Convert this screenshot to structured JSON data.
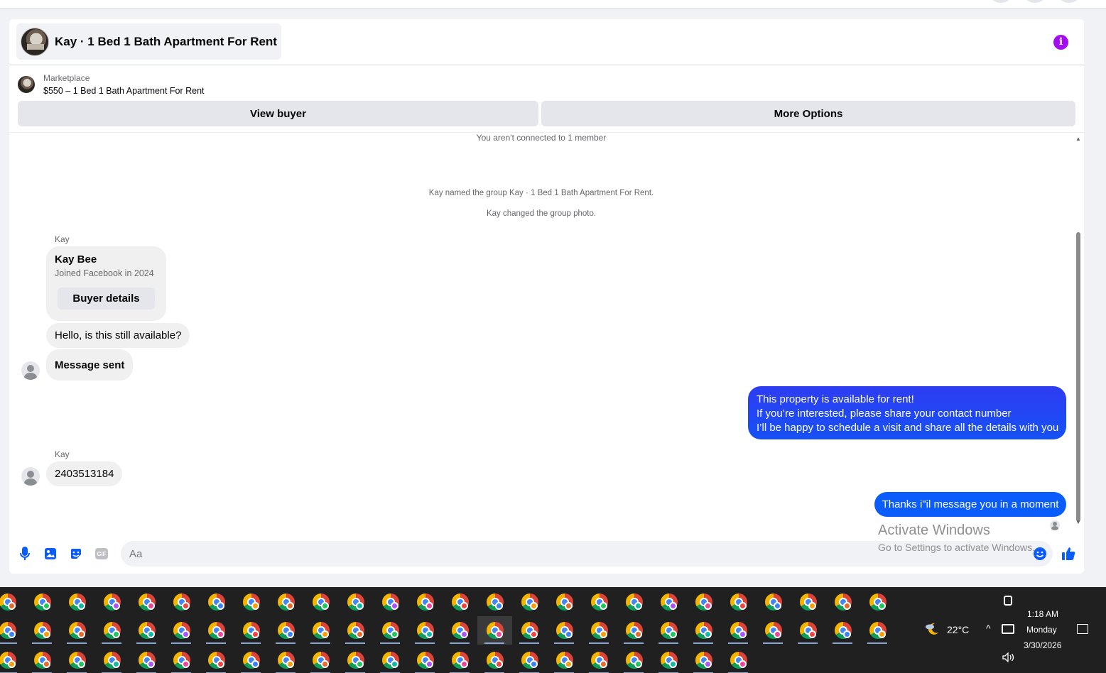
{
  "header": {
    "title": "Kay · 1 Bed 1 Bath Apartment For Rent",
    "info_icon": "info-icon",
    "info_glyph": "i"
  },
  "marketplace": {
    "label": "Marketplace",
    "listing_title": "$550 – 1 Bed 1 Bath Apartment For Rent"
  },
  "actions": {
    "view_buyer": "View buyer",
    "more_options": "More Options"
  },
  "system_messages": {
    "not_connected": "You aren't connected to 1 member",
    "named_group": "Kay named the group Kay · 1 Bed 1 Bath Apartment For Rent.",
    "changed_photo": "Kay changed the group photo."
  },
  "messages": {
    "sender_1": "Kay",
    "buyer_card": {
      "name": "Kay Bee",
      "joined": "Joined Facebook in 2024",
      "button": "Buyer details"
    },
    "in_1": "Hello, is this still available?",
    "in_2": "Message sent",
    "out_1_lines": [
      "This property is available for rent!",
      "If you’re interested, please share your contact number",
      "I’ll be happy to schedule a visit and share all the details with you"
    ],
    "sender_2": "Kay",
    "in_3": "2403513184",
    "out_2": "Thanks i\"il message you in a moment"
  },
  "composer": {
    "placeholder": "Aa",
    "icons": [
      "microphone-icon",
      "photo-icon",
      "sticker-icon",
      "gif-icon",
      "emoji-icon",
      "like-icon"
    ],
    "gif_label": "GIF"
  },
  "watermark": {
    "line1": "Activate Windows",
    "line2": "Go to Settings to activate Windows."
  },
  "taskbar": {
    "weather_temp": "22°C",
    "time": "1:18 AM",
    "day": "Monday",
    "date": "3/30/2026"
  },
  "colors": {
    "accent_blue": "#0a5cfd",
    "info_purple": "#a30ef0",
    "bubble_gray": "#f0f0f0"
  }
}
